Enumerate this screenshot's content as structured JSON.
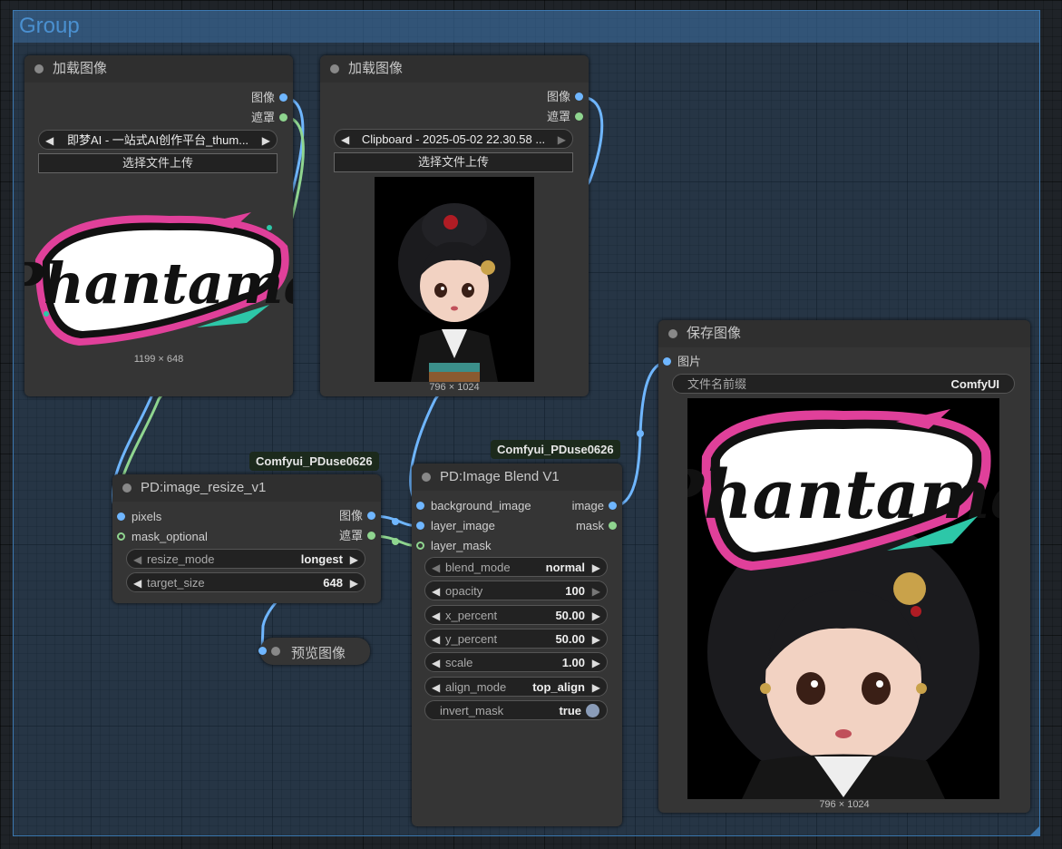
{
  "group": {
    "title": "Group"
  },
  "load_node_1": {
    "title": "加载图像",
    "outputs": [
      "图像",
      "遮罩"
    ],
    "file": "即梦AI - 一站式AI创作平台_thum...",
    "upload_label": "选择文件上传",
    "image_text": "Phantama",
    "dims": "1199 × 648"
  },
  "load_node_2": {
    "title": "加载图像",
    "outputs": [
      "图像",
      "遮罩"
    ],
    "file": "Clipboard - 2025-05-02 22.30.58 ...",
    "upload_label": "选择文件上传",
    "dims": "796 × 1024"
  },
  "resize_node": {
    "badge": "Comfyui_PDuse0626",
    "title": "PD:image_resize_v1",
    "inputs": [
      "pixels",
      "mask_optional"
    ],
    "outputs": [
      "图像",
      "遮罩"
    ],
    "widgets": [
      {
        "label": "resize_mode",
        "value": "longest"
      },
      {
        "label": "target_size",
        "value": "648"
      }
    ]
  },
  "preview_node": {
    "title": "预览图像"
  },
  "blend_node": {
    "badge": "Comfyui_PDuse0626",
    "title": "PD:Image Blend V1",
    "inputs": [
      "background_image",
      "layer_image",
      "layer_mask"
    ],
    "outputs": [
      "image",
      "mask"
    ],
    "widgets": [
      {
        "label": "blend_mode",
        "value": "normal"
      },
      {
        "label": "opacity",
        "value": "100"
      },
      {
        "label": "x_percent",
        "value": "50.00"
      },
      {
        "label": "y_percent",
        "value": "50.00"
      },
      {
        "label": "scale",
        "value": "1.00"
      },
      {
        "label": "align_mode",
        "value": "top_align"
      }
    ],
    "toggle": {
      "label": "invert_mask",
      "value": "true"
    }
  },
  "save_node": {
    "title": "保存图像",
    "input": "图片",
    "prefix_label": "文件名前缀",
    "prefix_value": "ComfyUI",
    "image_text": "Phantama",
    "dims": "796 × 1024"
  },
  "colors": {
    "image_link": "#6fb6ff",
    "mask_link": "#8fd58f",
    "group_border": "#3c78b0"
  }
}
